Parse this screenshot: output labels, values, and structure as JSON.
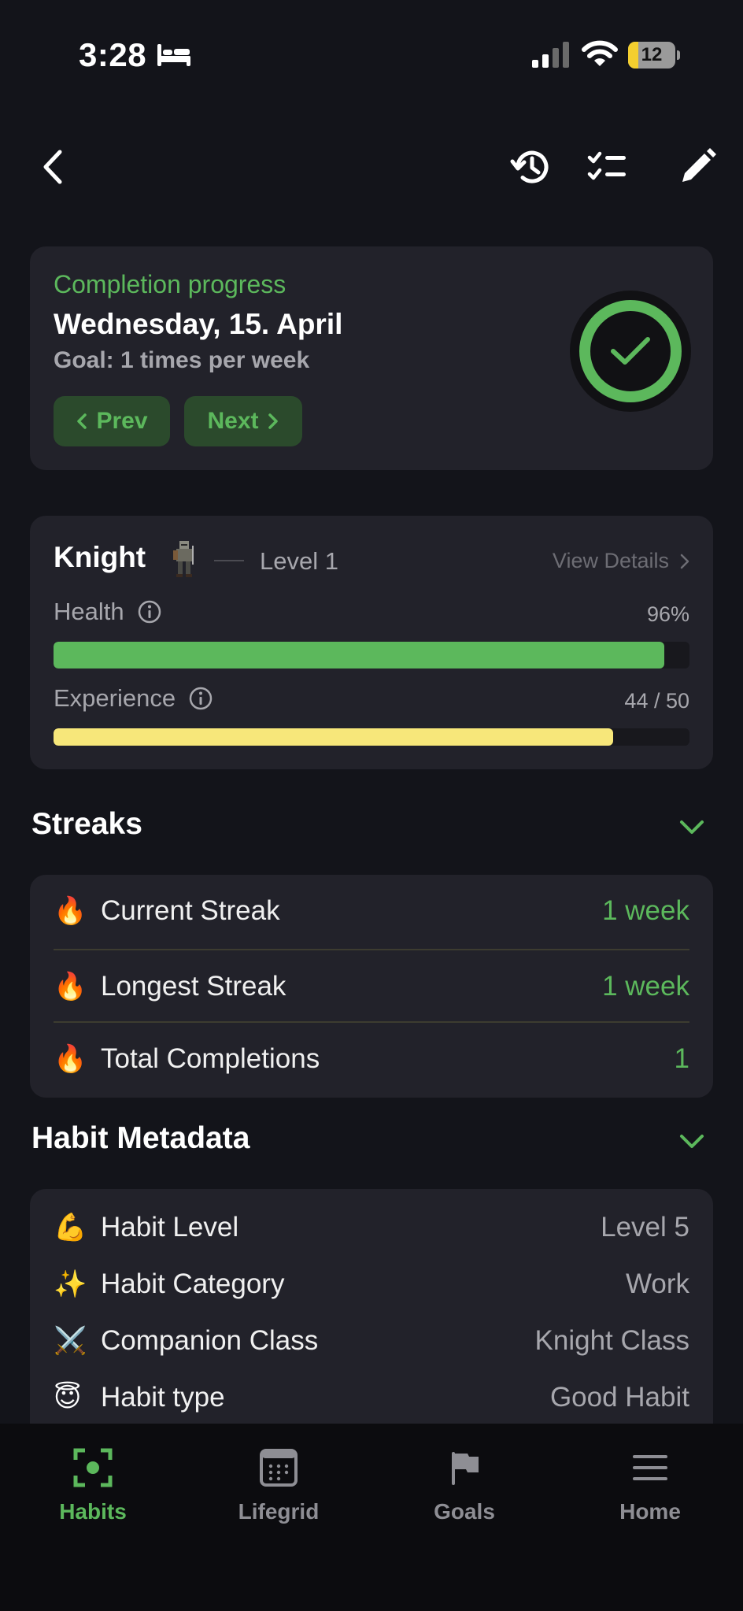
{
  "status_bar": {
    "time": "3:28",
    "battery_level": "12"
  },
  "progress": {
    "label": "Completion progress",
    "date": "Wednesday, 15. April",
    "goal": "Goal: 1 times per week",
    "prev_label": "Prev",
    "next_label": "Next"
  },
  "companion": {
    "name": "Knight",
    "level": "Level 1",
    "view_details": "View Details",
    "health_label": "Health",
    "health_value": "96%",
    "health_fraction": 0.96,
    "experience_label": "Experience",
    "experience_value": "44 / 50",
    "experience_fraction": 0.88
  },
  "streaks": {
    "title": "Streaks",
    "rows": [
      {
        "icon": "fire-icon",
        "emoji": "🔥",
        "label": "Current Streak",
        "value": "1 week"
      },
      {
        "icon": "fire-icon",
        "emoji": "🔥",
        "label": "Longest Streak",
        "value": "1 week"
      },
      {
        "icon": "fire-icon",
        "emoji": "🔥",
        "label": "Total Completions",
        "value": "1"
      }
    ]
  },
  "metadata": {
    "title": "Habit Metadata",
    "rows": [
      {
        "icon": "flexed-biceps-icon",
        "emoji": "💪",
        "label": "Habit Level",
        "value": "Level 5"
      },
      {
        "icon": "sparkles-icon",
        "emoji": "✨",
        "label": "Habit Category",
        "value": "Work"
      },
      {
        "icon": "crossed-swords-icon",
        "emoji": "⚔️",
        "label": "Companion Class",
        "value": "Knight Class"
      },
      {
        "icon": "halo-face-icon",
        "emoji": "😇",
        "label": "Habit type",
        "value": "Good Habit"
      }
    ]
  },
  "tabs": [
    {
      "label": "Habits",
      "active": true
    },
    {
      "label": "Lifegrid",
      "active": false
    },
    {
      "label": "Goals",
      "active": false
    },
    {
      "label": "Home",
      "active": false
    }
  ],
  "colors": {
    "accent": "#5cb85c",
    "health_bar": "#5cb85c",
    "experience_bar": "#f7e77a",
    "background": "#13141a",
    "card": "#22222a"
  }
}
